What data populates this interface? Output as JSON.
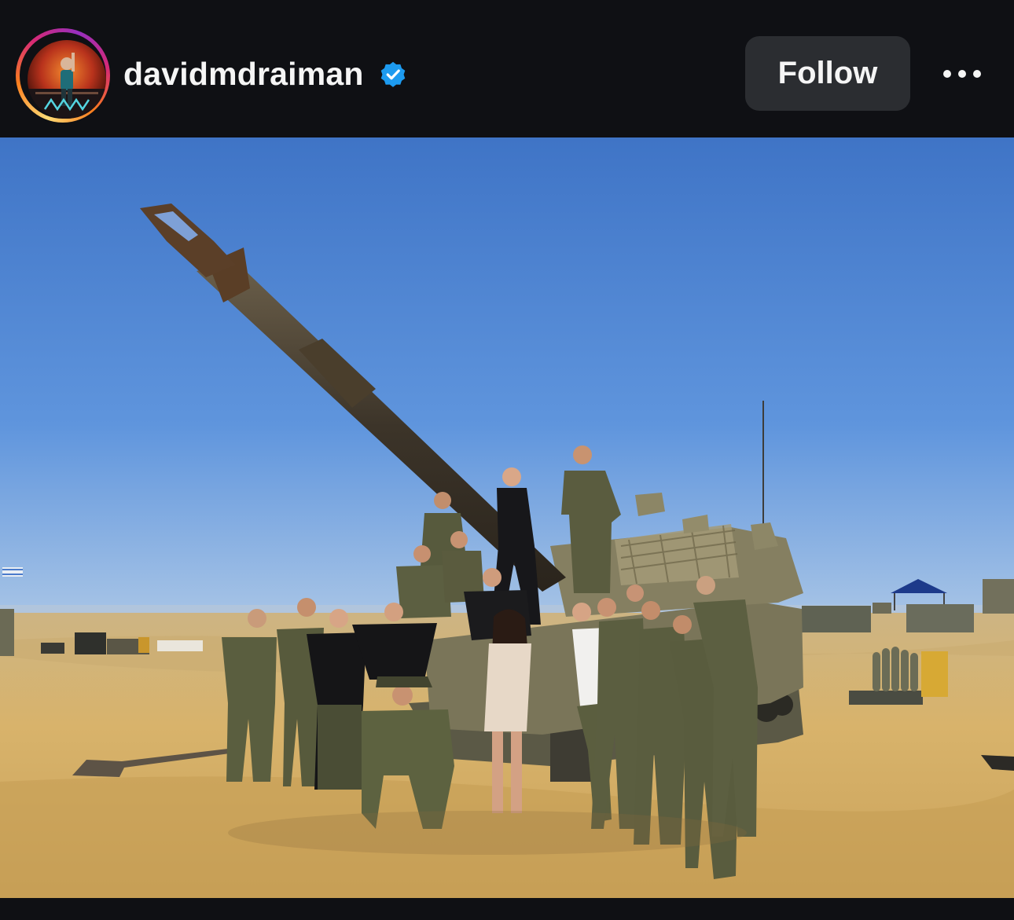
{
  "post": {
    "username": "davidmdraiman",
    "verified": true,
    "follow_label": "Follow",
    "more_icon": "more-horizontal-icon",
    "avatar_icon": "profile-avatar",
    "verified_icon": "verified-badge-icon"
  },
  "colors": {
    "background": "#0f1014",
    "text": "#f5f5f5",
    "button": "#2b2d31",
    "verified": "#1d9bf0",
    "sky_top": "#3b76c9",
    "ground": "#d7b36c"
  }
}
